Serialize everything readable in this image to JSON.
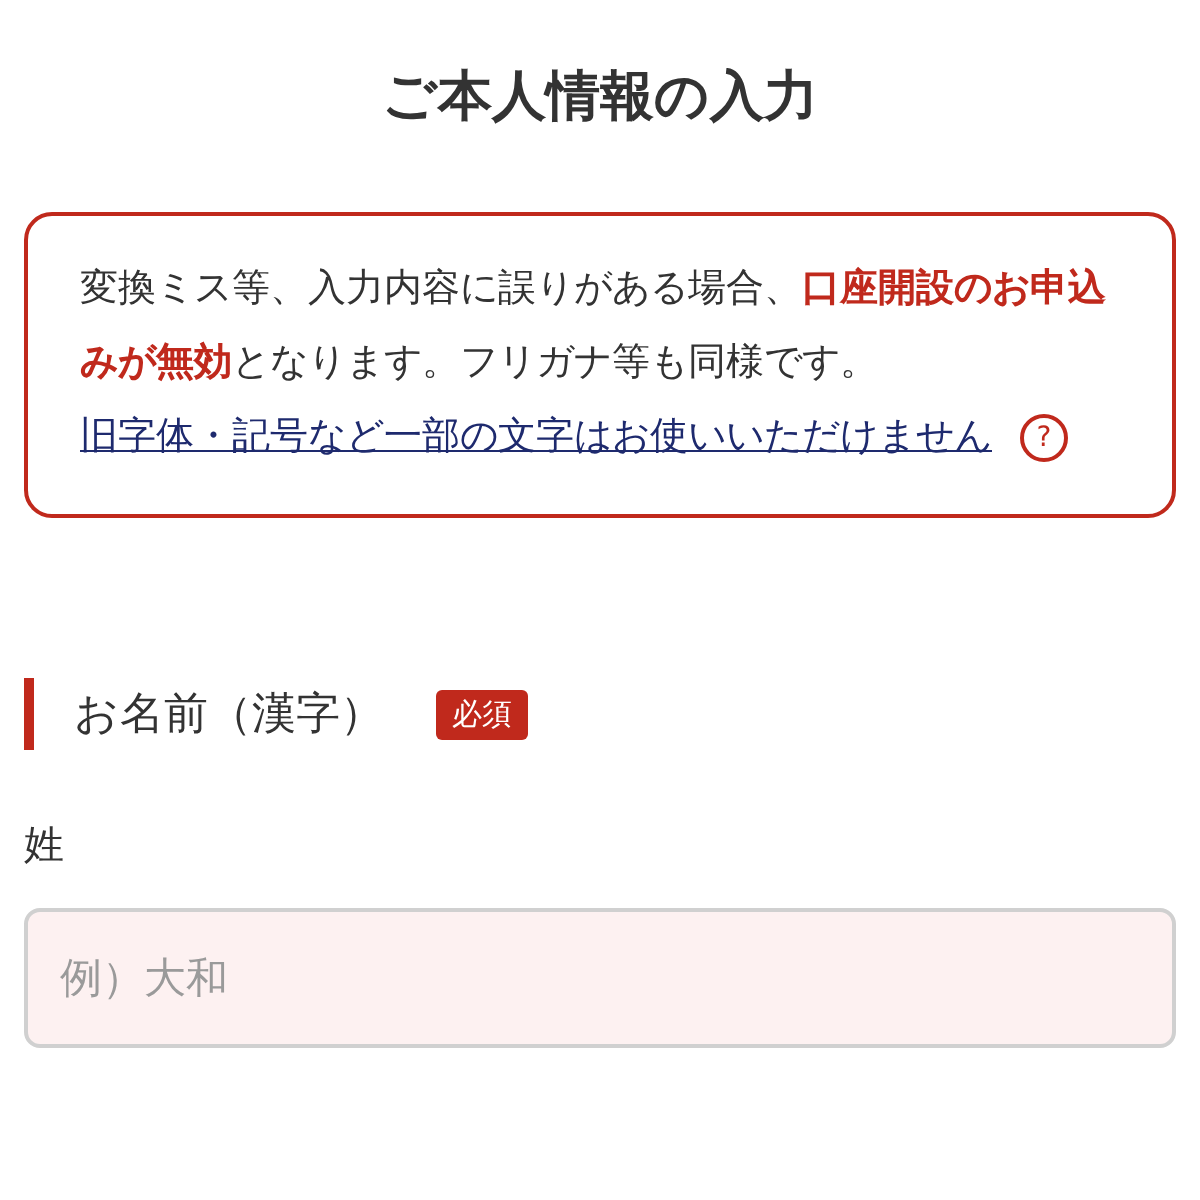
{
  "title": "ご本人情報の入力",
  "notice": {
    "text": "変換ミス等、入力内容に誤りがある場合、**口座開設のお申込みが無効**となります。フリガナ等も同様です。",
    "link": "旧字体・記号など一部の文字はお使いいただけません",
    "help": "?"
  },
  "section": {
    "label": "お名前（漢字）",
    "badge": "必須",
    "fields": [
      {
        "label": "姓",
        "placeholder": "例）大和"
      }
    ]
  }
}
